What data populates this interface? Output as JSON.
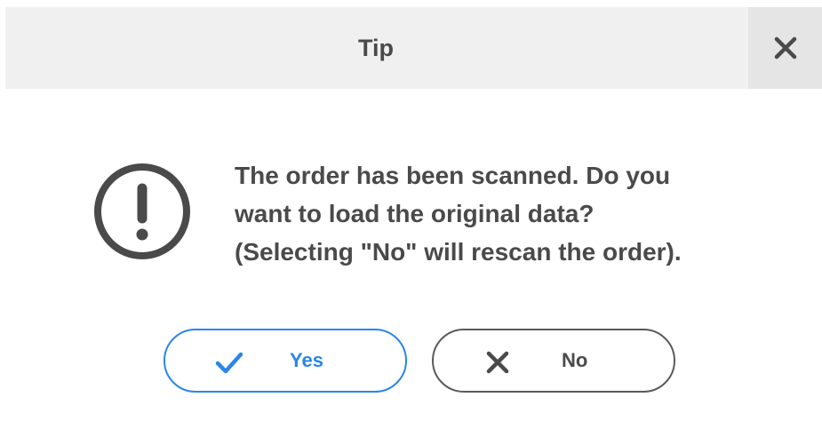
{
  "dialog": {
    "title": "Tip",
    "close_icon": "close-icon",
    "warning_icon": "exclamation-circle-icon",
    "message_lines": [
      "The order has been scanned. Do you",
      "want to load the original data?",
      "(Selecting \"No\" will rescan the order)."
    ],
    "buttons": {
      "yes": {
        "label": "Yes",
        "icon": "checkmark-icon"
      },
      "no": {
        "label": "No",
        "icon": "x-icon"
      }
    }
  },
  "colors": {
    "titlebar_bg": "#f0f0f0",
    "close_bg": "#e5e5e5",
    "text": "#4a4a4a",
    "accent": "#2a86e8",
    "no_border": "#5a5a5a"
  }
}
